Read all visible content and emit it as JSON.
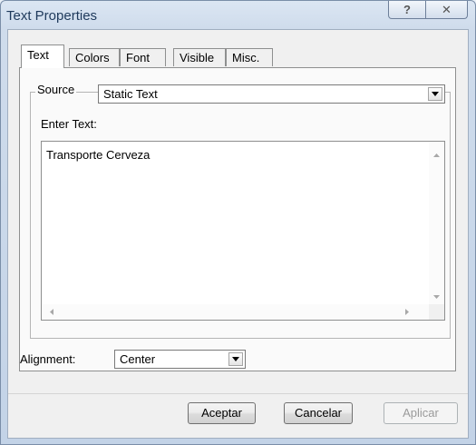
{
  "window": {
    "title": "Text Properties",
    "help_glyph": "?",
    "close_glyph": "✕"
  },
  "tabs": [
    "Text",
    "Colors",
    "Font",
    "Visible",
    "Misc."
  ],
  "active_tab": "Text",
  "source": {
    "label": "Source",
    "value": "Static Text"
  },
  "enter_text": {
    "label": "Enter Text:",
    "value": "Transporte Cerveza"
  },
  "alignment": {
    "label": "Alignment:",
    "value": "Center"
  },
  "buttons": {
    "ok": "Aceptar",
    "cancel": "Cancelar",
    "apply": "Aplicar"
  },
  "icons": [
    "help-icon",
    "close-icon",
    "dropdown-arrow-icon",
    "scroll-up-icon",
    "scroll-down-icon",
    "scroll-left-icon",
    "scroll-right-icon"
  ]
}
